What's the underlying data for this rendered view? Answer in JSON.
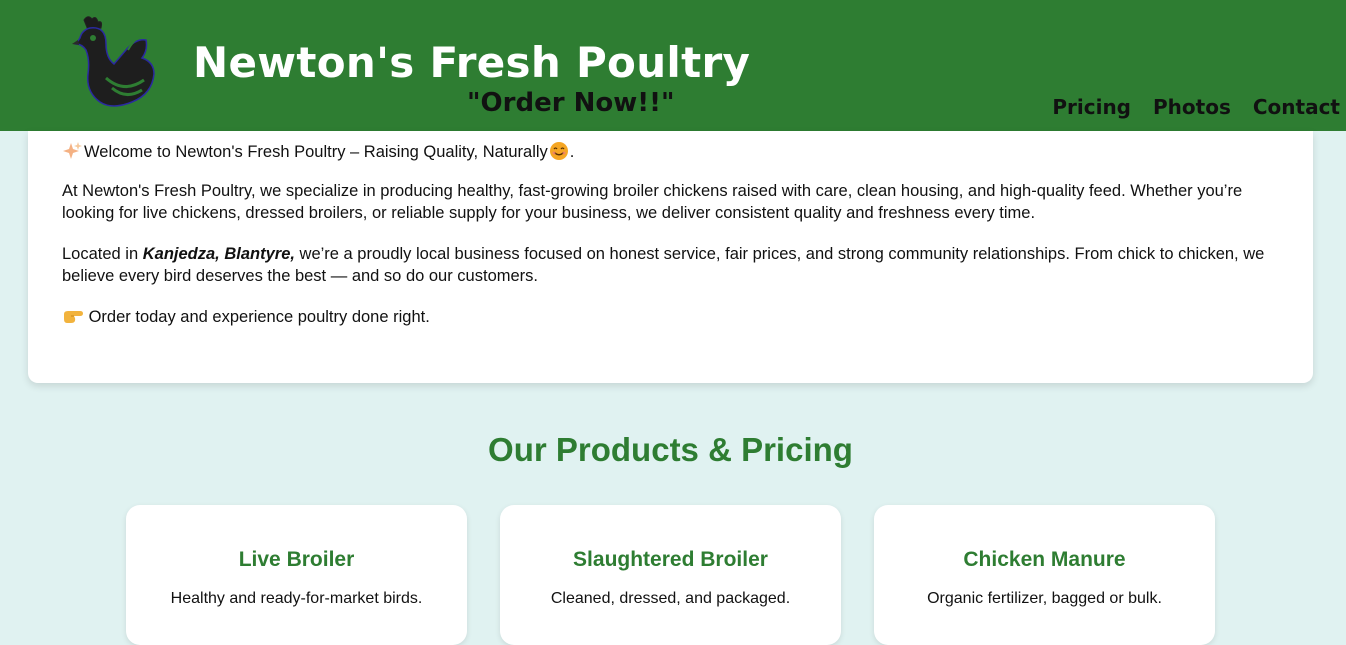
{
  "header": {
    "title": "Newton's Fresh Poultry",
    "tagline": "\"Order Now!!\"",
    "logo_icon": "hen-icon",
    "background_color": "#2e7d32",
    "nav": [
      {
        "label": "Pricing"
      },
      {
        "label": "Photos"
      },
      {
        "label": "Contact"
      }
    ]
  },
  "intro": {
    "welcome_icon": "sparkles-icon",
    "welcome_text": "Welcome to Newton's Fresh Poultry – Raising Quality, Naturally",
    "welcome_end_icon": "smiling-face-icon",
    "welcome_end": ".",
    "paragraph1": "At Newton's Fresh Poultry, we specialize in producing healthy, fast-growing broiler chickens raised with care, clean housing, and high-quality feed. Whether you’re looking for live chickens, dressed broilers, or reliable supply for your business, we deliver consistent quality and freshness every time.",
    "location_prefix": "Located in ",
    "location": "Kanjedza, Blantyre,",
    "location_rest": " we’re a proudly local business focused on honest service, fair prices, and strong community relationships. From chick to chicken, we believe every bird deserves the best — and so do our customers.",
    "cta_icon": "pointing-hand-icon",
    "cta_text": "Order today and experience poultry done right."
  },
  "products": {
    "section_title": "Our Products & Pricing",
    "accent_color": "#2e7d32",
    "items": [
      {
        "name": "Live Broiler",
        "description": "Healthy and ready-for-market birds."
      },
      {
        "name": "Slaughtered Broiler",
        "description": "Cleaned, dressed, and packaged."
      },
      {
        "name": "Chicken Manure",
        "description": "Organic fertilizer, bagged or bulk."
      }
    ]
  }
}
